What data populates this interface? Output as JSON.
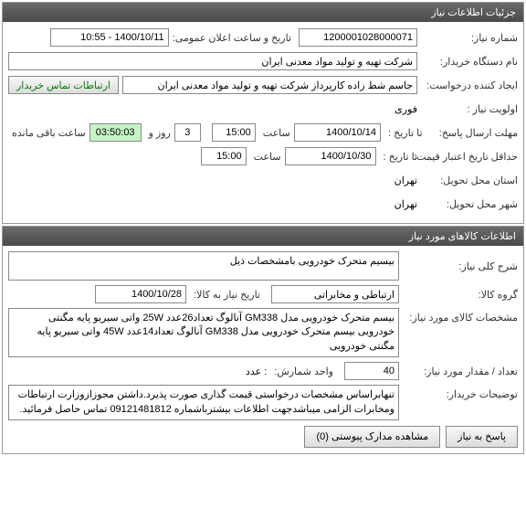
{
  "panel1": {
    "title": "جزئیات اطلاعات نیاز",
    "need_no_label": "شماره نیاز:",
    "need_no": "1200001028000071",
    "pub_date_label": "تاریخ و ساعت اعلان عمومی:",
    "pub_date": "1400/10/11 - 10:55",
    "org_label": "نام دستگاه خریدار:",
    "org": "شرکت تهیه و تولید مواد معدنی ایران",
    "creator_label": "ایجاد کننده درخواست:",
    "creator": "جاسم شط زاده کارپرداز شرکت تهیه و تولید مواد معدنی ایران",
    "contact_btn": "ارتباطات تماس خریدار",
    "priority_label": "اولویت نیاز :",
    "priority": "فوری",
    "deadline_label": "مهلت ارسال پاسخ:",
    "deadline_to": "تا تاریخ :",
    "deadline_date": "1400/10/14",
    "deadline_time_label": "ساعت",
    "deadline_time": "15:00",
    "days": "3",
    "days_label": "روز و",
    "timer": "03:50:03",
    "timer_label": "ساعت باقی مانده",
    "validity_label": "حداقل تاریخ اعتبار قیمت:",
    "validity_to": "تا تاریخ :",
    "validity_date": "1400/10/30",
    "validity_time": "15:00",
    "province_label": "استان محل تحویل:",
    "province": "تهران",
    "city_label": "شهر محل تحویل:",
    "city": "تهران"
  },
  "panel2": {
    "title": "اطلاعات کالاهای مورد نیاز",
    "desc_label": "شرح کلی نیاز:",
    "desc": "بیسیم متحرک خودرویی بامشخصات ذیل",
    "group_label": "گروه کالا:",
    "group": "ارتباطی و مخابراتی",
    "need_date_label": "تاریخ نیاز به کالا:",
    "need_date": "1400/10/28",
    "spec_label": "مشخصات کالای مورد نیاز:",
    "spec": "بیسم متحرک خودرویی مدل GM338 آنالوگ تعداد26عدد 25W واتی سیریو پایه مگنتی خودرویی بیسم متحرک خودرویی مدل GM338 آنالوگ تعداد14عدد 45W واتی سیریو پایه مگنتی خودرویی",
    "qty_label": "تعداد / مقدار مورد نیاز:",
    "qty": "40",
    "unit_label": "واحد شمارش:",
    "unit": ": عدد",
    "notes_label": "توضیحات خریدار:",
    "notes": "تنهابراساس مشخصات درخواستی قیمت گذاری صورت پذیرد.داشتن مجوزازوزارت ارتباطات ومخابرات الزامی میباشدجهت اطلاعات بیشترباشماره 09121481812 تماس حاصل فرمائید."
  },
  "buttons": {
    "reply": "پاسخ به نیاز",
    "attach": "مشاهده مدارک پیوستی (0)"
  }
}
